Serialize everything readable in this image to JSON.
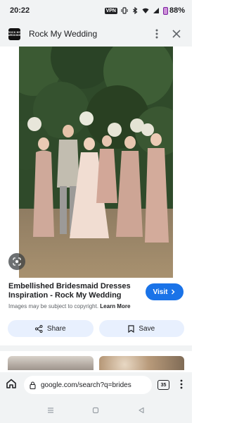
{
  "status_bar": {
    "time": "20:22",
    "vpn": "VPN",
    "battery": "88%"
  },
  "header": {
    "logo_text": "ROCK MY WEDDING",
    "site_name": "Rock My Wedding"
  },
  "result": {
    "title": "Embellished Bridesmaid Dresses Inspiration - Rock My Wedding",
    "visit_label": "Visit",
    "copyright": "Images may be subject to copyright.",
    "learn_more": "Learn More"
  },
  "actions": {
    "share_label": "Share",
    "save_label": "Save"
  },
  "urlbar": {
    "url": "google.com/search?q=brides",
    "tab_count": "35"
  },
  "colors": {
    "accent": "#1a73e8",
    "chip_bg": "#e8f0fe",
    "bar_bg": "#f1f3f4"
  },
  "icons": [
    "home-icon",
    "lock-icon",
    "share-icon",
    "bookmark-icon",
    "lens-icon",
    "more-vert-icon",
    "close-icon",
    "open-external-icon"
  ]
}
